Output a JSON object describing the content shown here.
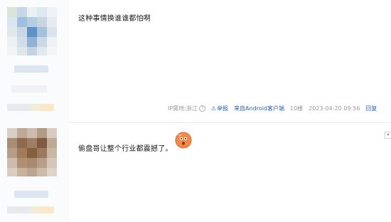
{
  "post1": {
    "content": "这种事情换谁谁都怕啊",
    "ip_label": "IP属地:浙江",
    "help_icon": "?",
    "report_label": "举报",
    "source_label": "来自Android客户端",
    "floor": "10楼",
    "timestamp": "2023-04-20 09:56",
    "reply_label": "回复"
  },
  "post2": {
    "content": "偷盘哥让整个行业都震撼了。",
    "emoji": "surprised-face-icon",
    "menu_glyph": "▾"
  },
  "colors": {
    "link_blue": "#2d64b3",
    "meta_gray": "#999999",
    "divider": "#e6e9ee"
  }
}
